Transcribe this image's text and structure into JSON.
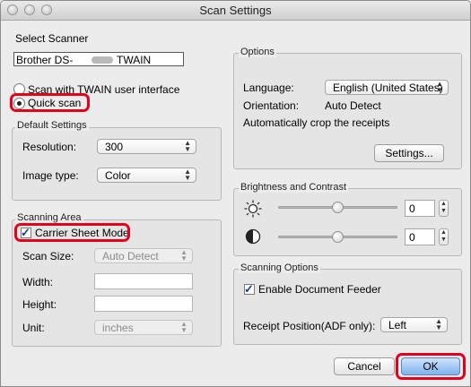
{
  "window": {
    "title": "Scan Settings"
  },
  "select_scanner": {
    "label": "Select Scanner",
    "scanner_name": "Brother DS-",
    "scanner_suffix": "TWAIN"
  },
  "scan_mode": {
    "twain_ui_label": "Scan with TWAIN user interface",
    "twain_ui_selected": false,
    "quick_scan_label": "Quick scan",
    "quick_scan_selected": true
  },
  "default_settings": {
    "title": "Default Settings",
    "resolution_label": "Resolution:",
    "resolution_value": "300",
    "image_type_label": "Image type:",
    "image_type_value": "Color"
  },
  "scanning_area": {
    "title": "Scanning Area",
    "carrier_sheet_label": "Carrier Sheet Mode",
    "carrier_sheet_checked": true,
    "scan_size_label": "Scan Size:",
    "scan_size_value": "Auto Detect",
    "width_label": "Width:",
    "width_value": "",
    "height_label": "Height:",
    "height_value": "",
    "unit_label": "Unit:",
    "unit_value": "inches"
  },
  "options": {
    "title": "Options",
    "language_label": "Language:",
    "language_value": "English (United States)",
    "orientation_label": "Orientation:",
    "orientation_value": "Auto Detect",
    "auto_crop_label": "Automatically crop the receipts",
    "settings_button": "Settings..."
  },
  "brightness_contrast": {
    "title": "Brightness and Contrast",
    "brightness_value": "0",
    "contrast_value": "0"
  },
  "scanning_options": {
    "title": "Scanning Options",
    "doc_feeder_label": "Enable Document Feeder",
    "doc_feeder_checked": true,
    "receipt_position_label": "Receipt Position(ADF only):",
    "receipt_position_value": "Left"
  },
  "buttons": {
    "cancel": "Cancel",
    "ok": "OK"
  },
  "highlight_color": "#e3001b"
}
